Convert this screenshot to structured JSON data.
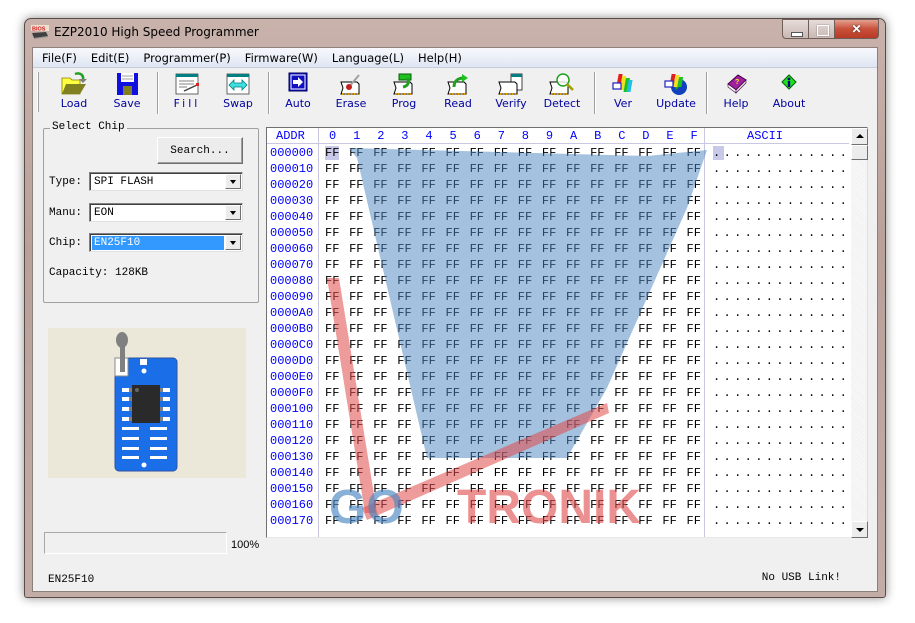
{
  "window": {
    "title": "EZP2010 High Speed Programmer",
    "app_icon_text": "BIOS"
  },
  "menu": [
    {
      "label": "File(F)"
    },
    {
      "label": "Edit(E)"
    },
    {
      "label": "Programmer(P)"
    },
    {
      "label": "Firmware(W)"
    },
    {
      "label": "Language(L)"
    },
    {
      "label": "Help(H)"
    }
  ],
  "toolbar": [
    {
      "label": "Load",
      "icon": "folder-open-icon"
    },
    {
      "label": "Save",
      "icon": "floppy-disk-icon"
    },
    {
      "label": "Fill",
      "icon": "fill-icon"
    },
    {
      "label": "Swap",
      "icon": "swap-icon"
    },
    {
      "label": "Auto",
      "icon": "auto-arrow-icon"
    },
    {
      "label": "Erase",
      "icon": "erase-chip-icon"
    },
    {
      "label": "Prog",
      "icon": "program-chip-icon"
    },
    {
      "label": "Read",
      "icon": "read-chip-icon"
    },
    {
      "label": "Verify",
      "icon": "verify-chip-icon"
    },
    {
      "label": "Detect",
      "icon": "detect-chip-icon"
    },
    {
      "label": "Ver",
      "icon": "version-icon"
    },
    {
      "label": "Update",
      "icon": "update-globe-icon"
    },
    {
      "label": "Help",
      "icon": "help-book-icon"
    },
    {
      "label": "About",
      "icon": "info-icon"
    }
  ],
  "select_chip": {
    "legend": "Select Chip",
    "search_label": "Search...",
    "type_label": "Type:",
    "type_value": "SPI FLASH",
    "manu_label": "Manu:",
    "manu_value": "EON",
    "chip_label": "Chip:",
    "chip_value": "EN25F10",
    "capacity_text": "Capacity: 128KB"
  },
  "progress": {
    "value_percent": 100,
    "label": "100%"
  },
  "status": {
    "chip": "EN25F10",
    "usb": "No USB Link!"
  },
  "hex_view": {
    "addr_header": "ADDR",
    "ascii_header": "ASCII",
    "columns": [
      "0",
      "1",
      "2",
      "3",
      "4",
      "5",
      "6",
      "7",
      "8",
      "9",
      "A",
      "B",
      "C",
      "D",
      "E",
      "F"
    ],
    "addresses": [
      "000000",
      "000010",
      "000020",
      "000030",
      "000040",
      "000050",
      "000060",
      "000070",
      "000080",
      "000090",
      "0000A0",
      "0000B0",
      "0000C0",
      "0000D0",
      "0000E0",
      "0000F0",
      "000100",
      "000110",
      "000120",
      "000130",
      "000140",
      "000150",
      "000160",
      "000170"
    ],
    "fill_byte": "FF",
    "ascii_row": "................",
    "cursor": {
      "row": 0,
      "col": 0
    }
  },
  "watermark": {
    "text_blue": "GO",
    "text_red": "TRONIK",
    "color_blue": "#4a86c0",
    "color_red": "#e04848"
  },
  "colors": {
    "addr_blue": "#0000ff",
    "toolbar_label": "#0000a0",
    "selection": "#3399ff"
  }
}
